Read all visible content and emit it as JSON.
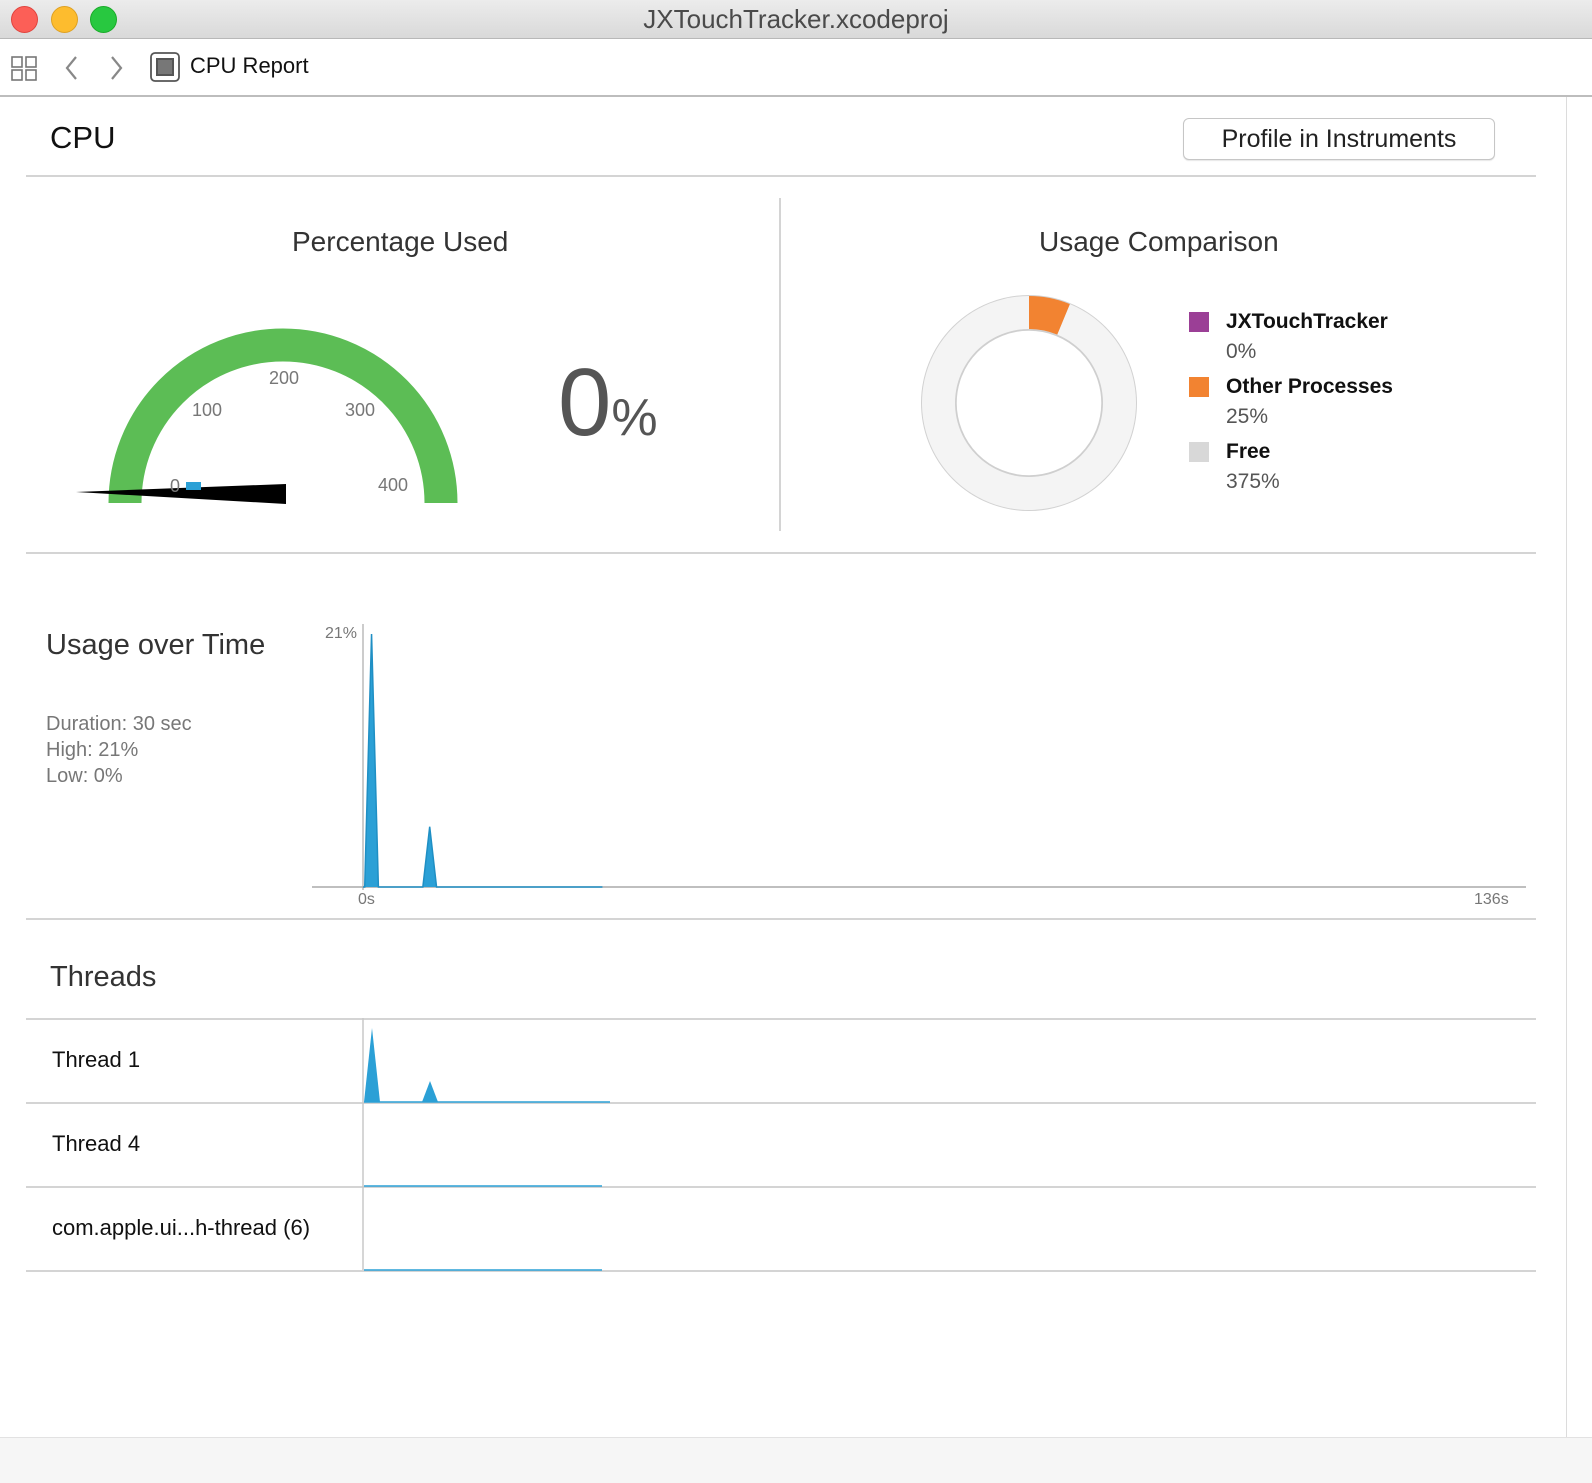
{
  "window": {
    "title": "JXTouchTracker.xcodeproj"
  },
  "jumpbar": {
    "breadcrumb": "CPU Report"
  },
  "header": {
    "title": "CPU",
    "profile_button": "Profile in Instruments"
  },
  "percentage_used": {
    "title": "Percentage Used",
    "value": "0",
    "unit": "%",
    "gauge": {
      "ticks": [
        "0",
        "100",
        "200",
        "300",
        "400"
      ],
      "min": 0,
      "max": 400,
      "needle_value": 0
    }
  },
  "usage_comparison": {
    "title": "Usage Comparison",
    "legend": [
      {
        "name": "JXTouchTracker",
        "value": "0%",
        "color": "#9b3f96"
      },
      {
        "name": "Other Processes",
        "value": "25%",
        "color": "#f28331"
      },
      {
        "name": "Free",
        "value": "375%",
        "color": "#d8d8d8"
      }
    ]
  },
  "usage_over_time": {
    "title": "Usage over Time",
    "duration": "Duration: 30 sec",
    "high": "High: 21%",
    "low": "Low: 0%",
    "y_max_label": "21%",
    "x_start_label": "0s",
    "x_end_label": "136s"
  },
  "threads": {
    "title": "Threads",
    "items": [
      {
        "name": "Thread 1"
      },
      {
        "name": "Thread 4"
      },
      {
        "name": "com.apple.ui...h-thread (6)"
      }
    ]
  },
  "chart_data": [
    {
      "type": "pie",
      "title": "Usage Comparison",
      "categories": [
        "JXTouchTracker",
        "Other Processes",
        "Free"
      ],
      "values": [
        0,
        25,
        375
      ],
      "colors": [
        "#9b3f96",
        "#f28331",
        "#d8d8d8"
      ]
    },
    {
      "type": "area",
      "title": "Usage over Time",
      "x_unit": "s",
      "y_unit": "%",
      "xlim": [
        0,
        136
      ],
      "ylim": [
        0,
        21
      ],
      "series": [
        {
          "x": [
            0,
            0.2,
            1,
            1.8,
            2,
            6,
            7,
            7.8,
            8.6,
            9,
            28
          ],
          "values": [
            0,
            0,
            21,
            0,
            0,
            0,
            0,
            5,
            0,
            0,
            0
          ]
        }
      ]
    }
  ]
}
